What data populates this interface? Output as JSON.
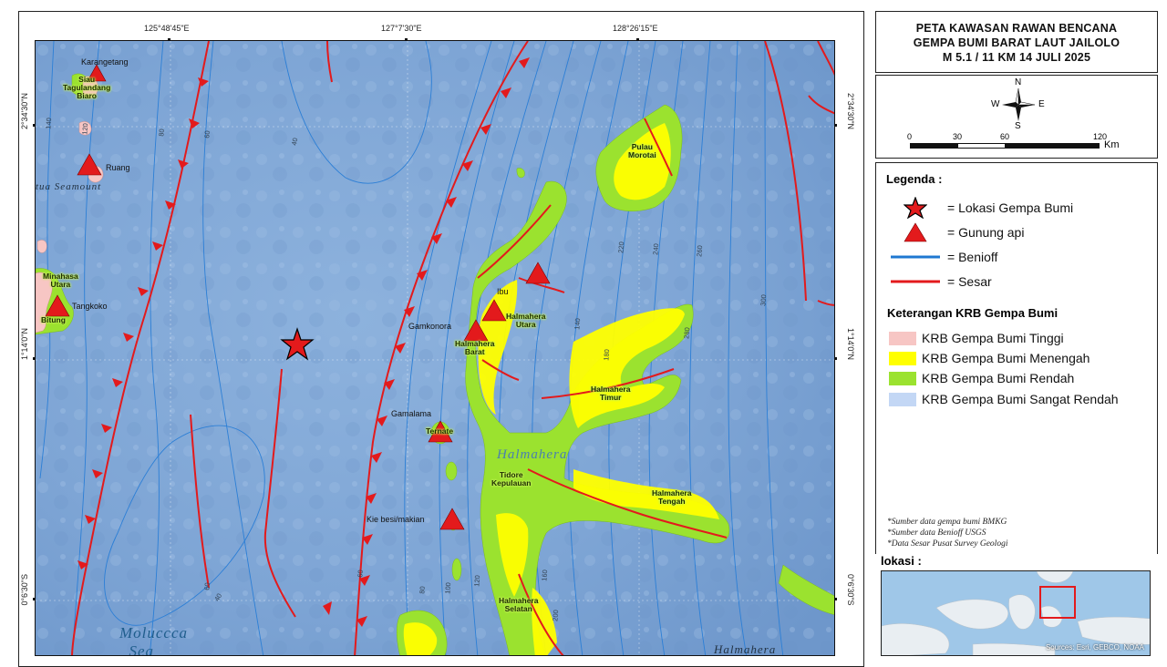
{
  "title": {
    "line1": "PETA KAWASAN RAWAN BENCANA",
    "line2": "GEMPA BUMI BARAT LAUT JAILOLO",
    "line3": "M 5.1 / 11 KM  14 JULI 2025"
  },
  "coords": {
    "top": [
      "125°48'45\"E",
      "127°7'30\"E",
      "128°26'15\"E"
    ],
    "left": [
      "2°34'30\"N",
      "1°14'0\"N",
      "0°6'30\"S"
    ],
    "right": [
      "2°34'30\"N",
      "1°14'0\"N",
      "0°6'30\"S"
    ]
  },
  "north_arrow": {
    "n": "N",
    "s": "S",
    "e": "E",
    "w": "W"
  },
  "scale_bar": {
    "ticks": [
      "0",
      "30",
      "60",
      "120"
    ],
    "unit": "Km"
  },
  "legend": {
    "heading": "Legenda :",
    "items": [
      {
        "symbol": "star",
        "label": "= Lokasi Gempa Bumi"
      },
      {
        "symbol": "triangle",
        "label": "= Gunung api"
      },
      {
        "symbol": "blue-line",
        "label": "= Benioff"
      },
      {
        "symbol": "red-line",
        "label": "= Sesar"
      }
    ],
    "krb_heading": "Keterangan KRB Gempa Bumi",
    "krb_items": [
      {
        "label": "KRB Gempa Bumi Tinggi",
        "color": "#f7c6c4"
      },
      {
        "label": "KRB Gempa Bumi  Menengah",
        "color": "#ffff00"
      },
      {
        "label": "KRB Gempa Bumi Rendah",
        "color": "#9be22f"
      },
      {
        "label": "KRB Gempa Bumi Sangat Rendah",
        "color": "#c3d7f5"
      }
    ],
    "notes": [
      "*Sumber data gempa bumi BMKG",
      "*Sumber data Benioff USGS",
      "*Data Sesar Pusat Survey Geologi"
    ]
  },
  "lokasi": {
    "label": "lokasi :",
    "source": "Sources: Esri, GEBCO, NOAA"
  },
  "map": {
    "volcano_labels": [
      "Karangetang",
      "Ruang",
      "Tangkoko",
      "Ibu",
      "Gamkonora",
      "Gamalama",
      "Kie besi/makian"
    ],
    "region_labels": [
      "Siau\nTagulandang\nBiaro",
      "Minahasa\nUtara",
      "Bitung",
      "Pulau\nMorotai",
      "Halmahera\nUtara",
      "Halmahera\nBarat",
      "Halmahera\nTimur",
      "Ternate",
      "Tidore\nKepulauan",
      "Halmahera\nTengah",
      "Halmahera\nSelatan"
    ],
    "sea_labels": [
      "Halmahera",
      "Moluccca\nSea",
      "tua Seamount",
      "Halmahera"
    ],
    "contours": [
      "140",
      "120",
      "80",
      "60",
      "40",
      "40",
      "60",
      "80",
      "100",
      "120",
      "140",
      "160",
      "180",
      "200",
      "220",
      "240",
      "260",
      "280",
      "300",
      "60"
    ]
  },
  "colors": {
    "ocean": "#7fa6d6",
    "land_high": "#f7c6c4",
    "land_mid": "#ffff00",
    "land_low": "#9be22f",
    "fault": "#e31a1c",
    "benioff": "#1f78d1",
    "volcano": "#e31a1c"
  }
}
